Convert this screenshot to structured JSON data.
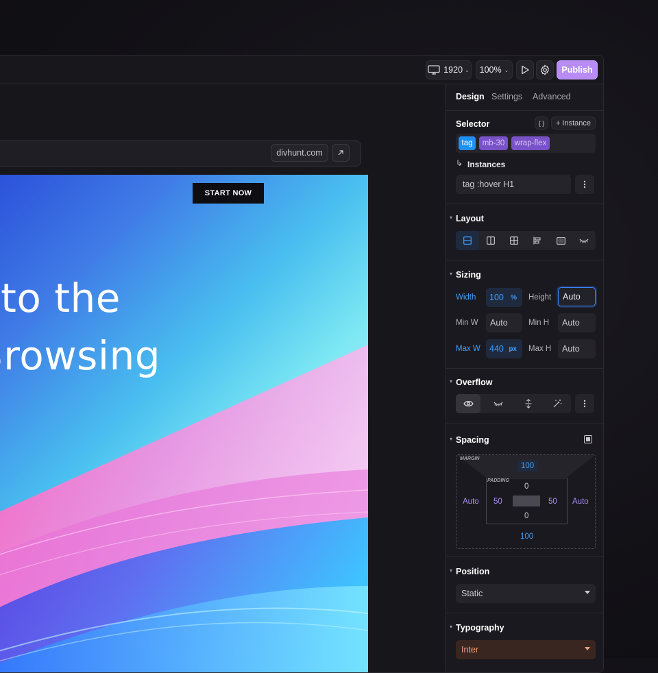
{
  "toolbar": {
    "resolution": "1920",
    "zoom": "100%",
    "publish_label": "Publish"
  },
  "browser": {
    "domain": "divhunt.com"
  },
  "site": {
    "start_button": "START NOW",
    "hero_line1": "me to the",
    "hero_line2": "of Browsing"
  },
  "panel": {
    "tabs": [
      "Design",
      "Settings",
      "Advanced"
    ],
    "selector": {
      "title": "Selector",
      "braces": "{ }",
      "instance_button": "+ Instance",
      "chips": [
        "tag",
        "mb-30",
        "wrap-flex"
      ],
      "instances_title": "Instances",
      "instance_value": "tag :hover H1"
    },
    "layout": {
      "title": "Layout"
    },
    "sizing": {
      "title": "Sizing",
      "width_label": "Width",
      "width_value": "100",
      "width_unit": "%",
      "height_label": "Height",
      "height_value": "Auto",
      "minw_label": "Min W",
      "minw_value": "Auto",
      "minh_label": "Min H",
      "minh_value": "Auto",
      "maxw_label": "Max W",
      "maxw_value": "440",
      "maxw_unit": "px",
      "maxh_label": "Max H",
      "maxh_value": "Auto"
    },
    "overflow": {
      "title": "Overflow"
    },
    "spacing": {
      "title": "Spacing",
      "margin_label": "MARGIN",
      "padding_label": "PADDING",
      "margin_top": "100",
      "margin_bottom": "100",
      "margin_left": "Auto",
      "margin_right": "Auto",
      "padding_top": "0",
      "padding_bottom": "0",
      "padding_left": "50",
      "padding_right": "50"
    },
    "position": {
      "title": "Position",
      "value": "Static"
    },
    "typography": {
      "title": "Typography",
      "font": "Inter"
    }
  },
  "colors": {
    "accent_blue": "#3ea0ff",
    "accent_purple": "#b98cf5",
    "chip_purple": "#8a5fd6",
    "chip_blue": "#1f8ff0",
    "font_select": "#f0a080"
  }
}
